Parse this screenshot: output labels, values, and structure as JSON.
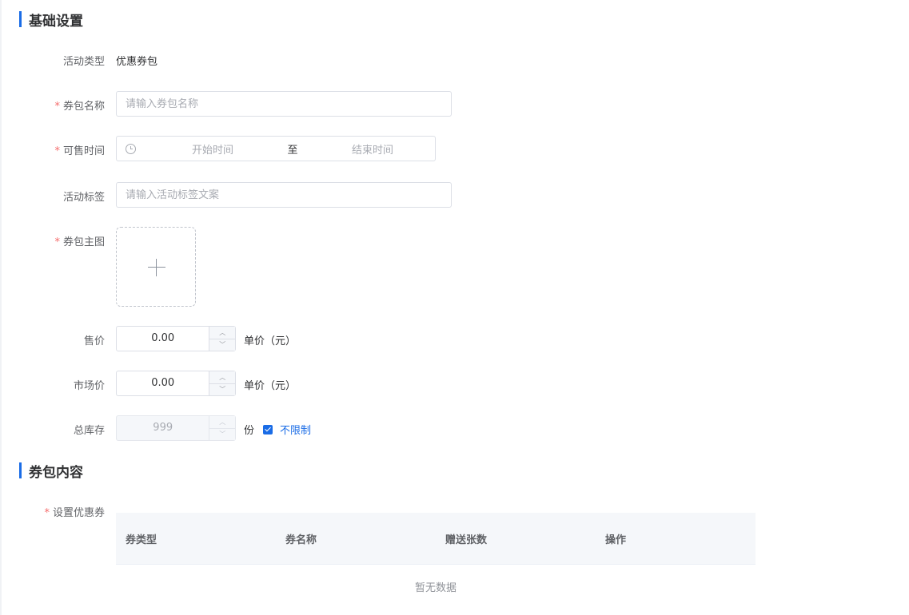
{
  "sections": {
    "basic": "基础设置",
    "content": "券包内容"
  },
  "fields": {
    "activity_type": {
      "label": "活动类型",
      "value": "优惠券包"
    },
    "package_name": {
      "label": "券包名称",
      "placeholder": "请输入券包名称",
      "required": true
    },
    "sale_time": {
      "label": "可售时间",
      "start_placeholder": "开始时间",
      "separator": "至",
      "end_placeholder": "结束时间",
      "required": true
    },
    "activity_tag": {
      "label": "活动标签",
      "placeholder": "请输入活动标签文案"
    },
    "main_image": {
      "label": "券包主图",
      "required": true
    },
    "price": {
      "label": "售价",
      "value": "0.00",
      "unit": "单价（元）"
    },
    "market_price": {
      "label": "市场价",
      "value": "0.00",
      "unit": "单价（元）"
    },
    "stock": {
      "label": "总库存",
      "value": "999",
      "unit": "份",
      "unlimited_label": "不限制",
      "unlimited_checked": true
    },
    "coupons": {
      "label": "设置优惠券",
      "required": true
    }
  },
  "table": {
    "columns": [
      "券类型",
      "券名称",
      "赠送张数",
      "操作"
    ],
    "empty_text": "暂无数据"
  },
  "colors": {
    "accent": "#1a6ce6",
    "required": "#f56c6c"
  }
}
